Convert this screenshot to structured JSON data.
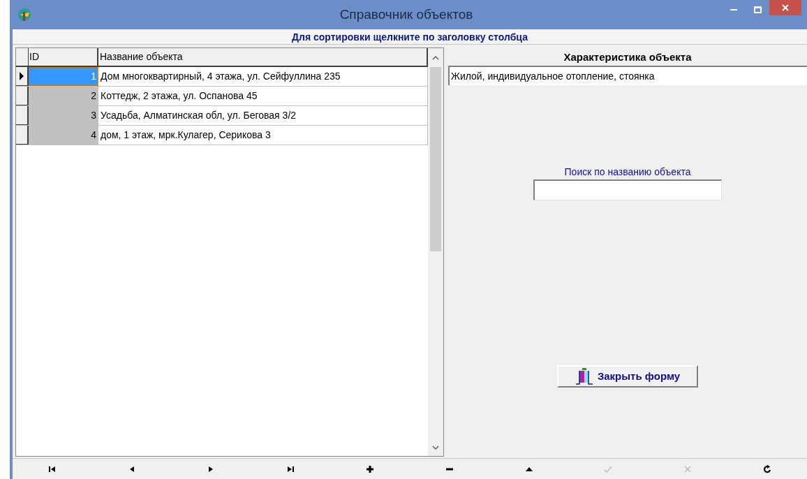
{
  "window": {
    "title": "Справочник объектов"
  },
  "sort_hint": "Для сортировки щелкните по заголовку столбца",
  "table": {
    "columns": [
      "ID",
      "Название объекта"
    ],
    "rows": [
      {
        "id": "1",
        "name": "Дом многоквартирный, 4 этажа, ул. Сейфуллина 235",
        "selected": true
      },
      {
        "id": "2",
        "name": "Коттедж, 2 этажа,  ул. Оспанова 45",
        "selected": false
      },
      {
        "id": "3",
        "name": "Усадьба, Алматинская обл, ул. Беговая 3/2",
        "selected": false
      },
      {
        "id": "4",
        "name": "дом, 1 этаж, мрк.Кулагер, Серикова 3",
        "selected": false
      }
    ]
  },
  "details": {
    "title": "Характеристика объекта",
    "value": "Жилой, индивидуальное отопление, стоянка"
  },
  "search": {
    "label": "Поиск по названию объекта"
  },
  "close_button": "Закрыть форму",
  "navigator": [
    {
      "kind": "first",
      "disabled": false
    },
    {
      "kind": "prior",
      "disabled": false
    },
    {
      "kind": "next",
      "disabled": false
    },
    {
      "kind": "last",
      "disabled": false
    },
    {
      "kind": "insert",
      "disabled": false
    },
    {
      "kind": "delete",
      "disabled": false
    },
    {
      "kind": "edit",
      "disabled": false
    },
    {
      "kind": "post",
      "disabled": true
    },
    {
      "kind": "cancel",
      "disabled": true
    },
    {
      "kind": "refresh",
      "disabled": false
    }
  ]
}
